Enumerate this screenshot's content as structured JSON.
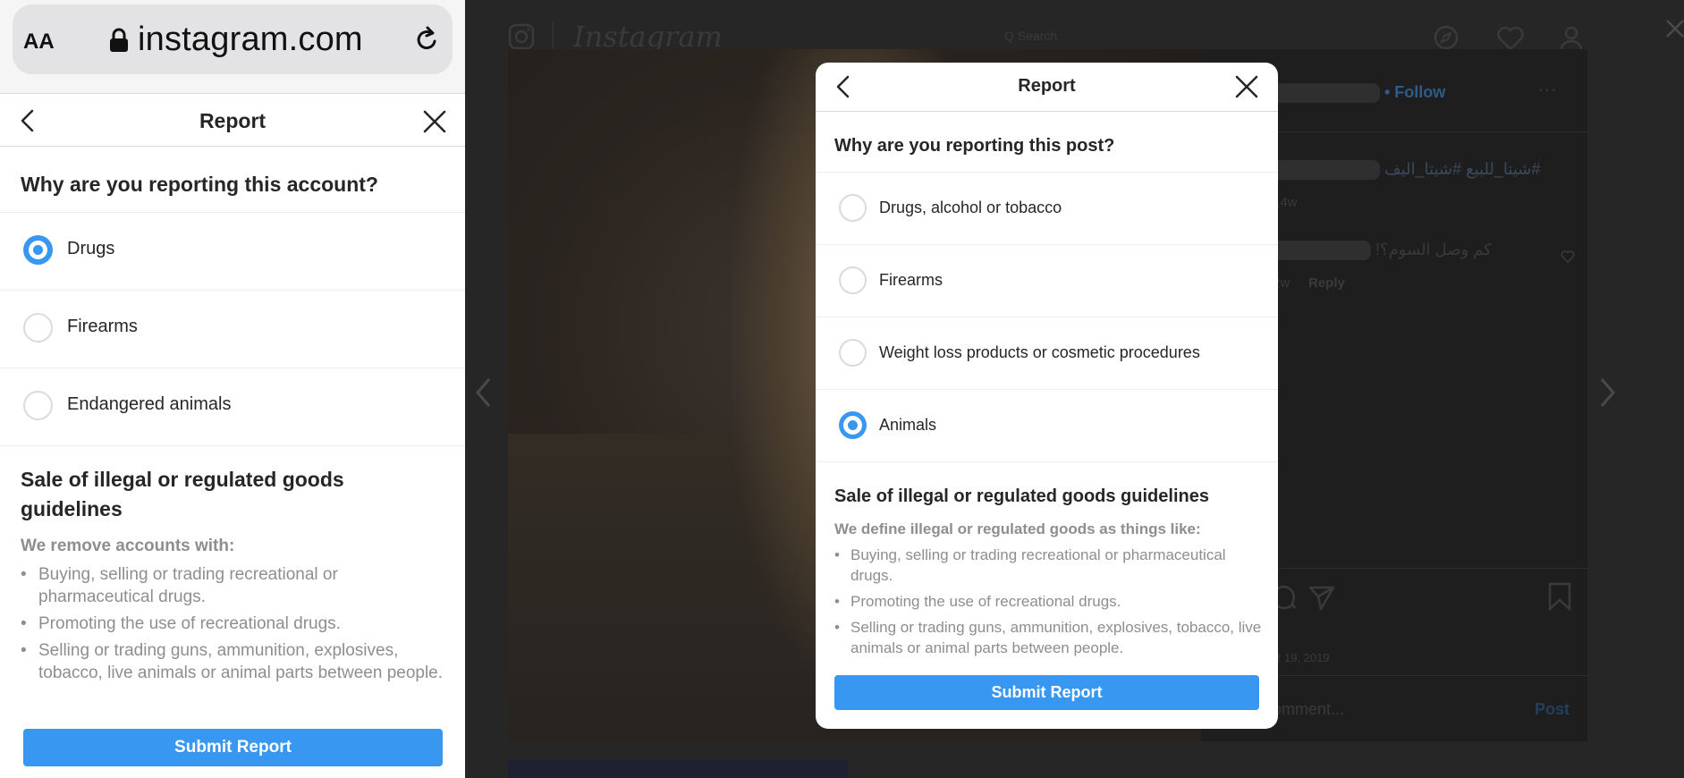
{
  "browser": {
    "text_size_label": "AA",
    "url": "instagram.com"
  },
  "mobile_report": {
    "title": "Report",
    "question": "Why are you reporting this account?",
    "options": [
      {
        "label": "Drugs",
        "selected": true
      },
      {
        "label": "Firearms",
        "selected": false
      },
      {
        "label": "Endangered animals",
        "selected": false
      }
    ],
    "guidelines_title": "Sale of illegal or regulated goods guidelines",
    "guidelines_intro": "We remove accounts with:",
    "guidelines": [
      "Buying, selling or trading recreational or pharmaceutical drugs.",
      "Promoting the use of recreational drugs.",
      "Selling or trading guns, ammunition, explosives, tobacco, live animals or animal parts between people."
    ],
    "submit_label": "Submit Report"
  },
  "desktop": {
    "logo_text": "Instagram",
    "search_placeholder": "Q Search",
    "post": {
      "follow_label": "• Follow",
      "caption": "شيتا_للبيع #شيتا_اليف#",
      "caption_age": "14w",
      "comment_text": "!كم وصل السوم؟",
      "comment_age": "2w",
      "reply_label": "Reply",
      "date": "R 19, 2019",
      "comment_placeholder": "omment...",
      "post_label": "Post"
    }
  },
  "desktop_report": {
    "title": "Report",
    "question": "Why are you reporting this post?",
    "options": [
      {
        "label": "Drugs, alcohol or tobacco",
        "selected": false
      },
      {
        "label": "Firearms",
        "selected": false
      },
      {
        "label": "Weight loss products or cosmetic procedures",
        "selected": false
      },
      {
        "label": "Animals",
        "selected": true
      }
    ],
    "guidelines_title": "Sale of illegal or regulated goods guidelines",
    "guidelines_intro": "We define illegal or regulated goods as things like:",
    "guidelines": [
      "Buying, selling or trading recreational or pharmaceutical drugs.",
      "Promoting the use of recreational drugs.",
      "Selling or trading guns, ammunition, explosives, tobacco, live animals or animal parts between people."
    ],
    "submit_label": "Submit Report"
  },
  "colors": {
    "accent": "#3897f0",
    "text_primary": "#262626",
    "text_secondary": "#8e8e8e",
    "overlay_bg": "#262626"
  }
}
